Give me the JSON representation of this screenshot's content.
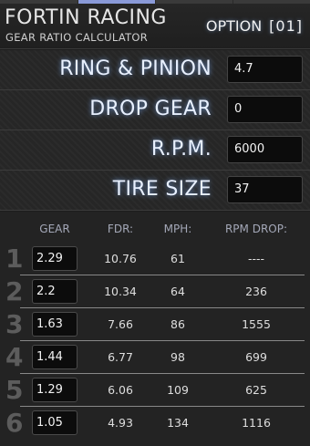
{
  "header": {
    "brand": "FORTIN RACING",
    "subtitle": "GEAR RATIO CALCULATOR",
    "option_label": "OPTION",
    "option_value": "[01]"
  },
  "inputs": [
    {
      "label": "RING & PINION",
      "value": "4.7"
    },
    {
      "label": "DROP GEAR",
      "value": "0"
    },
    {
      "label": "R.P.M.",
      "value": "6000"
    },
    {
      "label": "TIRE SIZE",
      "value": "37"
    }
  ],
  "table": {
    "headers": [
      "GEAR",
      "FDR:",
      "MPH:",
      "RPM DROP:"
    ],
    "rows": [
      {
        "num": "1",
        "gear": "2.29",
        "fdr": "10.76",
        "mph": "61",
        "rpm_drop": "----"
      },
      {
        "num": "2",
        "gear": "2.2",
        "fdr": "10.34",
        "mph": "64",
        "rpm_drop": "236"
      },
      {
        "num": "3",
        "gear": "1.63",
        "fdr": "7.66",
        "mph": "86",
        "rpm_drop": "1555"
      },
      {
        "num": "4",
        "gear": "1.44",
        "fdr": "6.77",
        "mph": "98",
        "rpm_drop": "699"
      },
      {
        "num": "5",
        "gear": "1.29",
        "fdr": "6.06",
        "mph": "109",
        "rpm_drop": "625"
      },
      {
        "num": "6",
        "gear": "1.05",
        "fdr": "4.93",
        "mph": "134",
        "rpm_drop": "1116"
      }
    ]
  },
  "colors": {
    "background": "#1c1c1c",
    "label_glow": "#82b4ff",
    "active_tab": "#8a9ad8",
    "input_box": "#0c0c0c",
    "gear_number": "#5c5c5c"
  }
}
